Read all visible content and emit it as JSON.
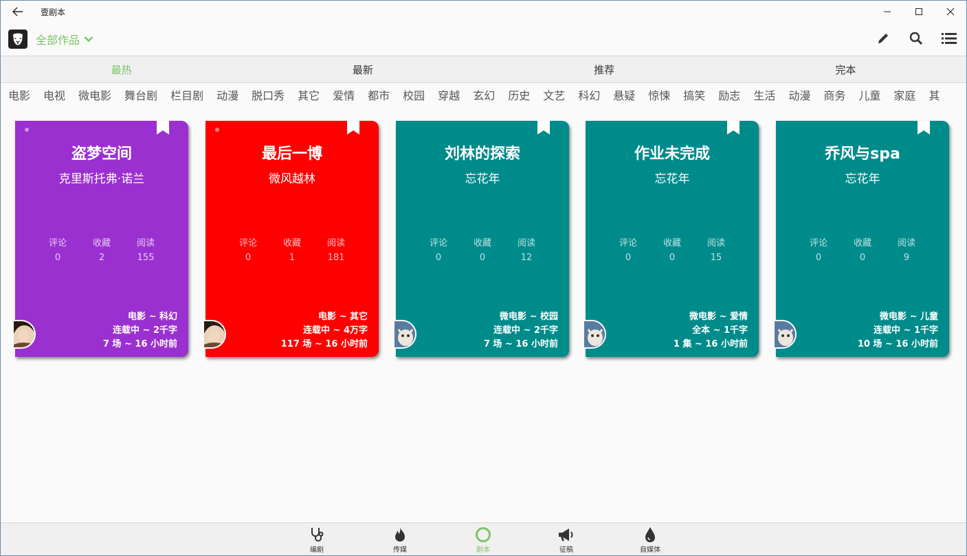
{
  "window": {
    "title": "壹剧本",
    "back_icon": "back-arrow-icon",
    "controls": [
      "minimize-icon",
      "maximize-icon",
      "close-icon"
    ]
  },
  "toolbar": {
    "filter_label": "全部作品",
    "accent": "#7cc466",
    "actions": [
      "edit-icon",
      "search-icon",
      "list-icon"
    ]
  },
  "tabs": [
    {
      "label": "最热",
      "active": true
    },
    {
      "label": "最新",
      "active": false
    },
    {
      "label": "推荐",
      "active": false
    },
    {
      "label": "完本",
      "active": false
    }
  ],
  "categories": [
    "电影",
    "电视",
    "微电影",
    "舞台剧",
    "栏目剧",
    "动漫",
    "脱口秀",
    "其它",
    "爱情",
    "都市",
    "校园",
    "穿越",
    "玄幻",
    "历史",
    "文艺",
    "科幻",
    "悬疑",
    "惊悚",
    "搞笑",
    "励志",
    "生活",
    "动漫",
    "商务",
    "儿童",
    "家庭",
    "其"
  ],
  "stat_labels": {
    "comments": "评论",
    "favorites": "收藏",
    "reads": "阅读"
  },
  "cards": [
    {
      "title": "盗梦空间",
      "author": "克里斯托弗·诺兰",
      "color": "#9b30d0",
      "comments": "0",
      "favorites": "2",
      "reads": "155",
      "genre": "电影 ~ 科幻",
      "status": "连载中 ~ 2千字",
      "scenes": "7 场 ~ 16 小时前",
      "has_dot": true
    },
    {
      "title": "最后一博",
      "author": "微风越林",
      "color": "#ff0000",
      "comments": "0",
      "favorites": "1",
      "reads": "181",
      "genre": "电影 ~ 其它",
      "status": "连载中 ~ 4万字",
      "scenes": "117 场 ~ 16 小时前",
      "has_dot": true
    },
    {
      "title": "刘林的探索",
      "author": "忘花年",
      "color": "#008b8b",
      "comments": "0",
      "favorites": "0",
      "reads": "12",
      "genre": "微电影 ~ 校园",
      "status": "连载中 ~ 2千字",
      "scenes": "7 场 ~ 16 小时前",
      "has_dot": false
    },
    {
      "title": "作业未完成",
      "author": "忘花年",
      "color": "#008b8b",
      "comments": "0",
      "favorites": "0",
      "reads": "15",
      "genre": "微电影 ~ 爱情",
      "status": "全本 ~ 1千字",
      "scenes": "1 集 ~ 16 小时前",
      "has_dot": false
    },
    {
      "title": "乔风与spa",
      "author": "忘花年",
      "color": "#008b8b",
      "comments": "0",
      "favorites": "0",
      "reads": "9",
      "genre": "微电影 ~ 儿童",
      "status": "连载中 ~ 1千字",
      "scenes": "10 场 ~ 16 小时前",
      "has_dot": false
    }
  ],
  "bottom_nav": [
    {
      "label": "编剧",
      "icon": "stethoscope-icon",
      "active": false
    },
    {
      "label": "传媒",
      "icon": "flame-icon",
      "active": false
    },
    {
      "label": "剧本",
      "icon": "circle-icon",
      "active": true
    },
    {
      "label": "征稿",
      "icon": "megaphone-icon",
      "active": false
    },
    {
      "label": "自媒体",
      "icon": "drop-icon",
      "active": false
    }
  ]
}
